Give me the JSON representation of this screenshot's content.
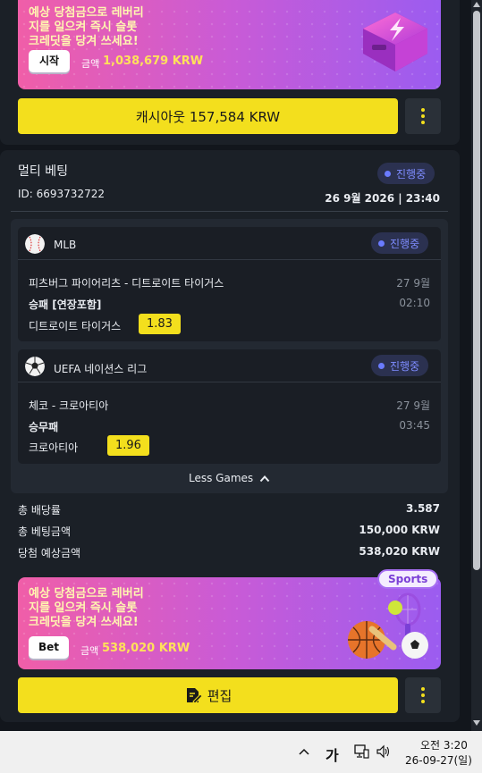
{
  "promo_top": {
    "text": "예상 당첨금으로 레버리\n지를 일으켜 즉시 슬롯\n크레딧을 당겨 쓰세요!",
    "button": "시작",
    "amount_label": "금액",
    "amount": "1,038,679 KRW"
  },
  "cashout": {
    "label": "캐시아웃 157,584 KRW"
  },
  "bet": {
    "title": "멀티 베팅",
    "status": "진행중",
    "id": "ID: 6693732722",
    "datetime": "26 9월 2026 | 23:40",
    "games": [
      {
        "league": "MLB",
        "status": "진행중",
        "match": "피츠버그 파이어리츠 - 디트로이트 타이거스",
        "date": "27 9월",
        "market": "승패 [연장포함]",
        "time": "02:10",
        "selection": "디트로이트 타이거스",
        "odds": "1.83"
      },
      {
        "league": "UEFA 네이션스 리그",
        "status": "진행중",
        "match": "체코 - 크로아티아",
        "date": "27 9월",
        "market": "승무패",
        "time": "03:45",
        "selection": "크로아티아",
        "odds": "1.96"
      }
    ],
    "less_games": "Less Games",
    "summary": [
      {
        "label": "총 배당률",
        "value": "3.587"
      },
      {
        "label": "총 베팅금액",
        "value": "150,000 KRW"
      },
      {
        "label": "당첨 예상금액",
        "value": "538,020 KRW"
      }
    ]
  },
  "promo_bottom": {
    "badge": "Sports",
    "text": "예상 당첨금으로 레버리\n지를 일으켜 즉시 슬롯\n크레딧을 당겨 쓰세요!",
    "button": "Bet",
    "amount_label": "금액",
    "amount": "538,020 KRW"
  },
  "edit": {
    "label": "편집"
  },
  "taskbar": {
    "ime": "가",
    "time": "오전 3:20",
    "date": "26-09-27(일)"
  },
  "colors": {
    "accent_yellow": "#f3df1d",
    "status_blue": "#7e8cff",
    "panel": "#1b2027"
  }
}
